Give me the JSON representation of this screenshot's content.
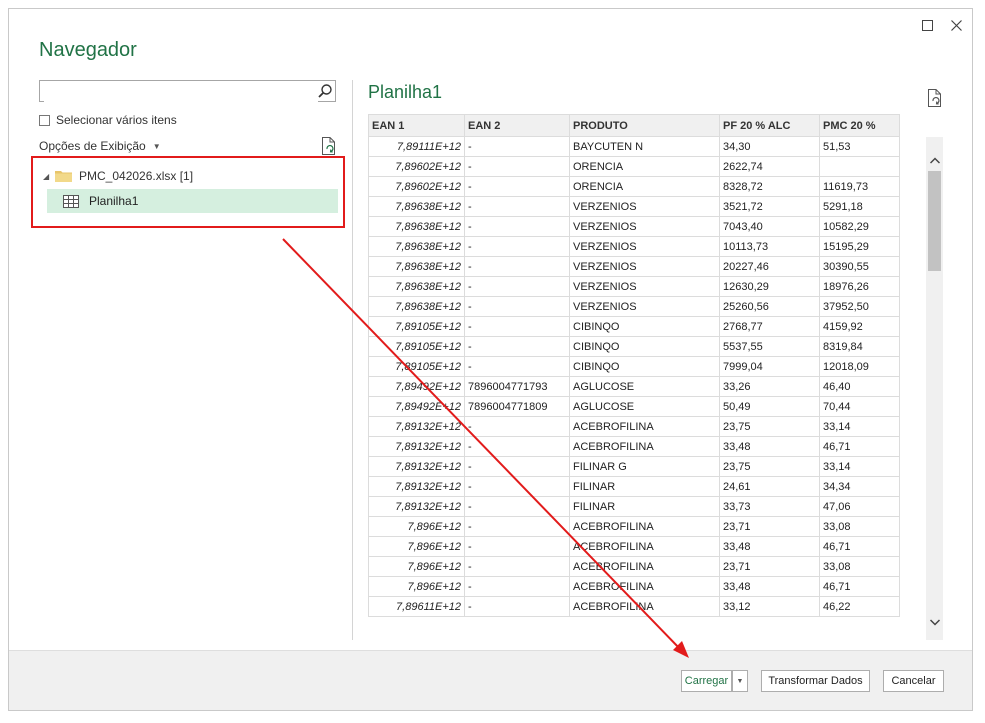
{
  "dialog": {
    "title": "Navegador",
    "search": {
      "value": "",
      "placeholder": ""
    },
    "select_multiple_label": "Selecionar vários itens",
    "display_options_label": "Opções de Exibição",
    "tree": {
      "file_label": "PMC_042026.xlsx [1]",
      "sheet_label": "Planilha1"
    },
    "preview": {
      "title": "Planilha1",
      "columns": [
        "EAN 1",
        "EAN 2",
        "PRODUTO",
        "PF 20 %  ALC",
        "PMC 20 %"
      ],
      "rows": [
        [
          "7,89111E+12",
          "-",
          "BAYCUTEN N",
          "34,30",
          "51,53"
        ],
        [
          "7,89602E+12",
          "-",
          "ORENCIA",
          "2622,74",
          ""
        ],
        [
          "7,89602E+12",
          "-",
          "ORENCIA",
          "8328,72",
          "11619,73"
        ],
        [
          "7,89638E+12",
          "-",
          "VERZENIOS",
          "3521,72",
          "5291,18"
        ],
        [
          "7,89638E+12",
          "-",
          "VERZENIOS",
          "7043,40",
          "10582,29"
        ],
        [
          "7,89638E+12",
          "-",
          "VERZENIOS",
          "10113,73",
          "15195,29"
        ],
        [
          "7,89638E+12",
          "-",
          "VERZENIOS",
          "20227,46",
          "30390,55"
        ],
        [
          "7,89638E+12",
          "-",
          "VERZENIOS",
          "12630,29",
          "18976,26"
        ],
        [
          "7,89638E+12",
          "-",
          "VERZENIOS",
          "25260,56",
          "37952,50"
        ],
        [
          "7,89105E+12",
          "-",
          "CIBINQO",
          "2768,77",
          "4159,92"
        ],
        [
          "7,89105E+12",
          "-",
          "CIBINQO",
          "5537,55",
          "8319,84"
        ],
        [
          "7,89105E+12",
          "-",
          "CIBINQO",
          "7999,04",
          "12018,09"
        ],
        [
          "7,89492E+12",
          "7896004771793",
          "AGLUCOSE",
          "33,26",
          "46,40"
        ],
        [
          "7,89492E+12",
          "7896004771809",
          "AGLUCOSE",
          "50,49",
          "70,44"
        ],
        [
          "7,89132E+12",
          "-",
          "ACEBROFILINA",
          "23,75",
          "33,14"
        ],
        [
          "7,89132E+12",
          "-",
          "ACEBROFILINA",
          "33,48",
          "46,71"
        ],
        [
          "7,89132E+12",
          "-",
          "FILINAR G",
          "23,75",
          "33,14"
        ],
        [
          "7,89132E+12",
          "-",
          "FILINAR",
          "24,61",
          "34,34"
        ],
        [
          "7,89132E+12",
          "-",
          "FILINAR",
          "33,73",
          "47,06"
        ],
        [
          "7,896E+12",
          "-",
          "ACEBROFILINA",
          "23,71",
          "33,08"
        ],
        [
          "7,896E+12",
          "-",
          "ACEBROFILINA",
          "33,48",
          "46,71"
        ],
        [
          "7,896E+12",
          "-",
          "ACEBROFILINA",
          "23,71",
          "33,08"
        ],
        [
          "7,896E+12",
          "-",
          "ACEBROFILINA",
          "33,48",
          "46,71"
        ],
        [
          "7,89611E+12",
          "-",
          "ACEBROFILINA",
          "33,12",
          "46,22"
        ]
      ]
    },
    "buttons": {
      "load": "Carregar",
      "transform": "Transformar Dados",
      "cancel": "Cancelar"
    }
  },
  "colors": {
    "accent": "#217346",
    "selection": "#d5efdf",
    "annotation": "#e21b1b"
  },
  "icons": [
    "maximize-icon",
    "close-icon",
    "search-icon",
    "refresh-icon",
    "folder-icon",
    "sheet-icon",
    "chevron-up-icon",
    "chevron-down-icon"
  ]
}
